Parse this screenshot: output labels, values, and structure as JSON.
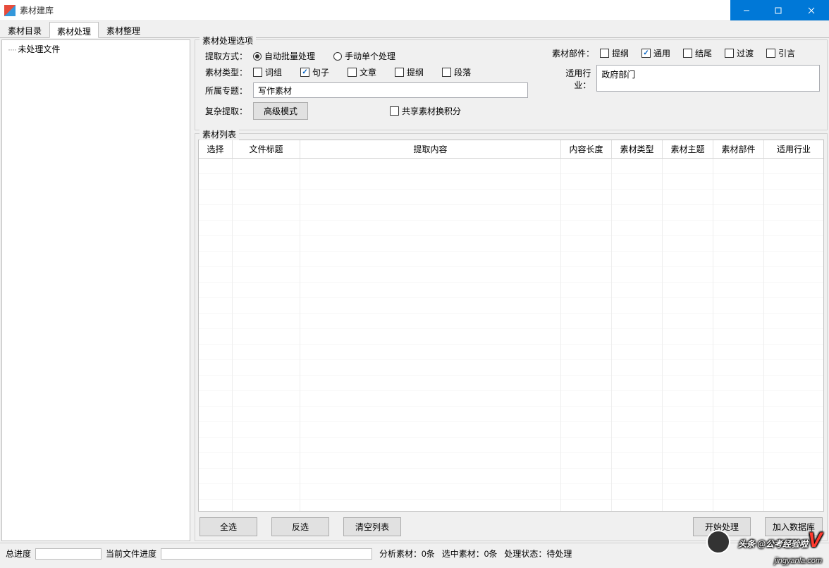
{
  "window": {
    "title": "素材建库"
  },
  "tabs": {
    "catalog": "素材目录",
    "process": "素材处理",
    "organize": "素材整理"
  },
  "sidebar": {
    "unprocessed": "未处理文件"
  },
  "options": {
    "legend": "素材处理选项",
    "extract_mode_label": "提取方式：",
    "mode_auto": "自动批量处理",
    "mode_manual": "手动单个处理",
    "material_type_label": "素材类型：",
    "type_phrase": "词组",
    "type_sentence": "句子",
    "type_article": "文章",
    "type_outline": "提纲",
    "type_paragraph": "段落",
    "topic_label": "所属专题：",
    "topic_value": "写作素材",
    "complex_label": "复杂提取：",
    "advanced_btn": "高级模式",
    "share_points": "共享素材换积分",
    "part_label": "素材部件：",
    "part_outline": "提纲",
    "part_general": "通用",
    "part_ending": "结尾",
    "part_transition": "过渡",
    "part_quote": "引言",
    "industry_label": "适用行业：",
    "industry_value": "政府部门"
  },
  "list": {
    "legend": "素材列表",
    "col_select": "选择",
    "col_title": "文件标题",
    "col_content": "提取内容",
    "col_length": "内容长度",
    "col_type": "素材类型",
    "col_topic": "素材主题",
    "col_part": "素材部件",
    "col_industry": "适用行业"
  },
  "actions": {
    "select_all": "全选",
    "invert": "反选",
    "clear": "清空列表",
    "start": "开始处理",
    "add_db": "加入数据库"
  },
  "status": {
    "total_progress": "总进度",
    "current_file": "当前文件进度",
    "analyzed": "分析素材：0条",
    "selected": "选中素材：0条",
    "state": "处理状态：待处理"
  },
  "watermark": {
    "text": "头条 @公考经验啦",
    "sub": "jingyanla.com"
  }
}
